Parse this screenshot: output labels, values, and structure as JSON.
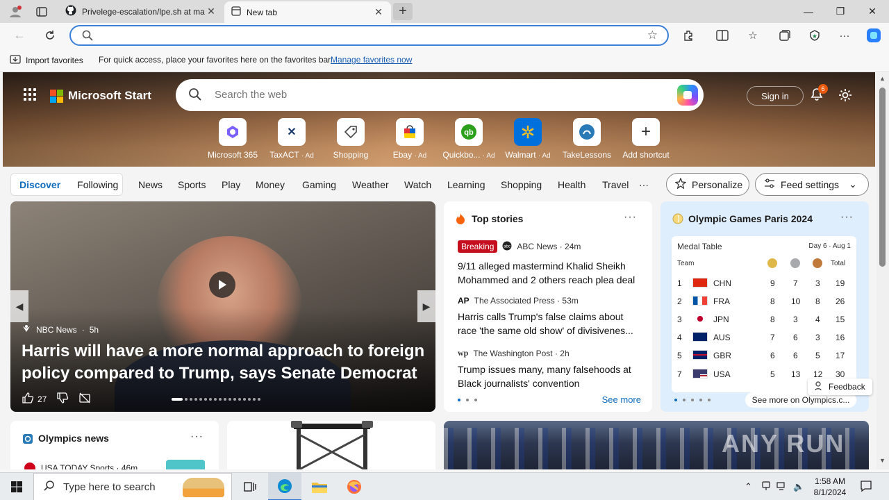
{
  "browser": {
    "tabs": [
      {
        "title": "Privelege-escalation/lpe.sh at ma",
        "active": false
      },
      {
        "title": "New tab",
        "active": true
      }
    ],
    "address": {
      "value": "",
      "placeholder": ""
    },
    "favorites_bar": {
      "import_label": "Import favorites",
      "message": "For quick access, place your favorites here on the favorites bar.",
      "manage_link": "Manage favorites now"
    }
  },
  "page": {
    "brand": "Microsoft Start",
    "search_placeholder": "Search the web",
    "signin": "Sign in",
    "notifications": "6",
    "shortcuts": [
      {
        "label": "Microsoft 365",
        "ad": "",
        "icon": "m365-icon",
        "color": "#7b61ff"
      },
      {
        "label": "TaxACT",
        "ad": "· Ad",
        "icon": "taxact-icon",
        "color": "#1b3a6b"
      },
      {
        "label": "Shopping",
        "ad": "",
        "icon": "tag-icon",
        "color": "#444444"
      },
      {
        "label": "Ebay",
        "ad": "· Ad",
        "icon": "ebay-icon",
        "color": "#e53238"
      },
      {
        "label": "Quickbo...",
        "ad": "· Ad",
        "icon": "quickbooks-icon",
        "color": "#2ca01c"
      },
      {
        "label": "Walmart",
        "ad": "· Ad",
        "icon": "walmart-icon",
        "color": "#0071dc"
      },
      {
        "label": "TakeLessons",
        "ad": "",
        "icon": "takelessons-icon",
        "color": "#2a7ab8"
      },
      {
        "label": "Add shortcut",
        "ad": "",
        "icon": "plus-icon",
        "color": "#333333"
      }
    ],
    "feed_tabs": {
      "discover": "Discover",
      "following": "Following"
    },
    "nav_links": [
      "News",
      "Sports",
      "Play",
      "Money",
      "Gaming",
      "Weather",
      "Watch",
      "Learning",
      "Shopping",
      "Health",
      "Travel",
      "···"
    ],
    "personalize": "Personalize",
    "feed_settings": "Feed settings",
    "main_story": {
      "source": "NBC News",
      "age": "5h",
      "headline": "Harris will have a more normal approach to foreign policy compared to Trump, says Senate Democrat",
      "likes": "27"
    },
    "top_stories": {
      "title": "Top stories",
      "see_more": "See more",
      "items": [
        {
          "badge": "Breaking",
          "source": "ABC News · 24m",
          "headline": "9/11 alleged mastermind Khalid Sheikh Mohammed and 2 others reach plea deal"
        },
        {
          "badge": "",
          "source": "The Associated Press · 53m",
          "headline": "Harris calls Trump's false claims about race 'the same old show' of divisivenes..."
        },
        {
          "badge": "",
          "source": "The Washington Post · 2h",
          "headline": "Trump issues many, many falsehoods at Black journalists' convention"
        }
      ]
    },
    "olympics": {
      "title": "Olympic Games Paris 2024",
      "table_title": "Medal Table",
      "day": "Day 6 · Aug 1",
      "col_team": "Team",
      "col_total": "Total",
      "rows": [
        {
          "rank": "1",
          "code": "CHN",
          "gold": "9",
          "silver": "7",
          "bronze": "3",
          "total": "19"
        },
        {
          "rank": "2",
          "code": "FRA",
          "gold": "8",
          "silver": "10",
          "bronze": "8",
          "total": "26"
        },
        {
          "rank": "3",
          "code": "JPN",
          "gold": "8",
          "silver": "3",
          "bronze": "4",
          "total": "15"
        },
        {
          "rank": "4",
          "code": "AUS",
          "gold": "7",
          "silver": "6",
          "bronze": "3",
          "total": "16"
        },
        {
          "rank": "5",
          "code": "GBR",
          "gold": "6",
          "silver": "6",
          "bronze": "5",
          "total": "17"
        },
        {
          "rank": "7",
          "code": "USA",
          "gold": "5",
          "silver": "13",
          "bronze": "12",
          "total": "30"
        }
      ],
      "see_more": "See more on Olympics.c..."
    },
    "olympics_news": {
      "title": "Olympics news",
      "source": "USA TODAY Sports · 46m"
    },
    "feedback": "Feedback",
    "watermark": "ANY RUN"
  },
  "taskbar": {
    "search_placeholder": "Type here to search",
    "time": "1:58 AM",
    "date": "8/1/2024"
  },
  "colors": {
    "accent": "#0f6cbd",
    "breaking": "#c50f1f",
    "address_border": "#3b7fd8"
  }
}
